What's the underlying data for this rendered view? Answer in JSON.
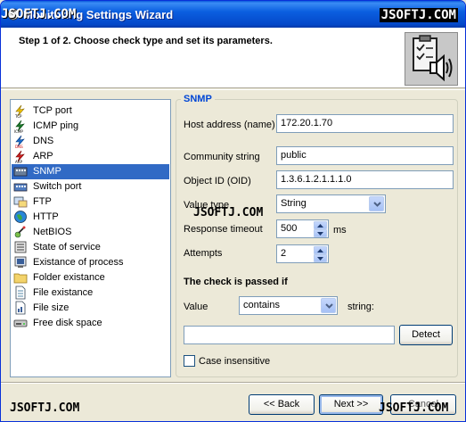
{
  "window": {
    "title": "Monitoring Settings Wizard",
    "title_overlay": "JSOFTJ.COM",
    "title_watermark": "JSOFTJ.COM"
  },
  "header": {
    "step_text": "Step 1 of 2. Choose check type and set its parameters.",
    "image_icon": "clipboard-speaker-icon"
  },
  "check_types": {
    "selected_index": 4,
    "items": [
      {
        "label": "TCP port",
        "icon": "tcp-icon"
      },
      {
        "label": "ICMP ping",
        "icon": "icmp-icon"
      },
      {
        "label": "DNS",
        "icon": "dns-icon"
      },
      {
        "label": "ARP",
        "icon": "arp-icon"
      },
      {
        "label": "SNMP",
        "icon": "snmp-icon"
      },
      {
        "label": "Switch port",
        "icon": "switch-icon"
      },
      {
        "label": "FTP",
        "icon": "ftp-icon"
      },
      {
        "label": "HTTP",
        "icon": "http-globe-icon"
      },
      {
        "label": "NetBIOS",
        "icon": "netbios-icon"
      },
      {
        "label": "State of service",
        "icon": "service-icon"
      },
      {
        "label": "Existance of process",
        "icon": "process-icon"
      },
      {
        "label": "Folder existance",
        "icon": "folder-icon"
      },
      {
        "label": "File existance",
        "icon": "file-icon"
      },
      {
        "label": "File size",
        "icon": "file-size-icon"
      },
      {
        "label": "Free disk space",
        "icon": "disk-icon"
      }
    ]
  },
  "snmp": {
    "group_title": "SNMP",
    "host_label": "Host address (name)",
    "host_value": "172.20.1.70",
    "community_label": "Community string",
    "community_value": "public",
    "oid_label": "Object ID (OID)",
    "oid_value": "1.3.6.1.2.1.1.1.0",
    "value_type_label": "Value type",
    "value_type_value": "String",
    "timeout_label": "Response timeout",
    "timeout_value": "500",
    "timeout_unit": "ms",
    "attempts_label": "Attempts",
    "attempts_value": "2",
    "passed_heading": "The check is passed if",
    "value_label": "Value",
    "condition_value": "contains",
    "string_label": "string:",
    "string_value": "",
    "detect_label": "Detect",
    "case_label": "Case insensitive",
    "case_checked": false
  },
  "footer": {
    "back_label": "<< Back",
    "next_label": "Next >>",
    "cancel_label": "Cancel"
  },
  "watermarks": {
    "middle": "JSOFTJ.COM",
    "bottom_left": "JSOFTJ.COM",
    "bottom_right": "JSOFTJ.COM"
  },
  "colors": {
    "title_bar": "#0b5fe0",
    "selection": "#316ac5",
    "group_title": "#0046d5",
    "dialog_bg": "#ece9d8"
  }
}
